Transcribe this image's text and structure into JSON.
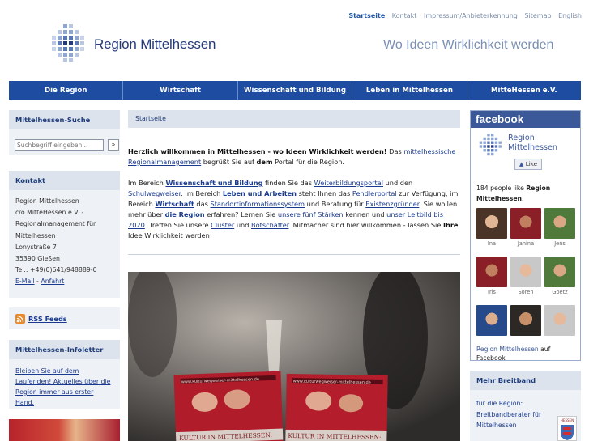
{
  "topnav": [
    "Startseite",
    "Kontakt",
    "Impressum/Anbieterkennung",
    "Sitemap",
    "English"
  ],
  "brand": {
    "logo_text": "Region Mittelhessen",
    "slogan": "Wo Ideen Wirklichkeit werden"
  },
  "mainnav": [
    "Die Region",
    "Wirtschaft",
    "Wissenschaft und Bildung",
    "Leben in Mittelhessen",
    "MitteHessen e.V."
  ],
  "search": {
    "title": "Mittelhessen-Suche",
    "placeholder": "Suchbegriff eingeben...",
    "button": "»"
  },
  "contact": {
    "title": "Kontakt",
    "lines": [
      "Region Mittelhessen",
      "c/o MitteHessen e.V. -",
      "Regionalmanagement für",
      "Mittelhessen",
      "Lonystraße 7",
      "35390 Gießen",
      "Tel.: +49(0)641/948889-0"
    ],
    "email": "E-Mail",
    "separator": " - ",
    "directions": "Anfahrt"
  },
  "rss": {
    "label": "RSS Feeds"
  },
  "infoletter": {
    "title": "Mittelhessen-Infoletter",
    "text": "Bleiben Sie auf dem Laufenden! Aktuelles über die Region immer aus erster Hand."
  },
  "breadcrumb": "Startseite",
  "intro": {
    "p1_bold": "Herzlich willkommen in Mittelhessen - wo Ideen Wirklichkeit werden!",
    "p1_a": " Das ",
    "p1_link": "mittelhessische Regionalmanagement",
    "p1_b": " begrüßt Sie auf ",
    "p1_bold2": "dem",
    "p1_c": " Portal für die Region.",
    "t1": "Im Bereich ",
    "l1": "Wissenschaft und Bildung",
    "t2": " finden Sie das ",
    "l2": "Weiterbildungsportal",
    "t3": " und den ",
    "l3": "Schulwegweiser",
    "t4": ". Im Bereich ",
    "l4": "Leben und Arbeiten",
    "t5": " steht Ihnen das ",
    "l5": "Pendlerportal",
    "t6": " zur Verfügung, im Bereich ",
    "l6": "Wirtschaft",
    "t7": " das ",
    "l7": "Standortinformationssystem",
    "t8": " und Beratung für ",
    "l8": "Existenzgründer",
    "t9": ". Sie wollen mehr über ",
    "l9": "die Region",
    "t10": " erfahren? Lernen Sie ",
    "l10": "unsere fünf Stärken",
    "t11": " kennen und ",
    "l11": "unser Leitbild bis 2020",
    "t12": ". Treffen Sie unsere ",
    "l12": "Cluster",
    "t13": " und ",
    "l13": "Botschafter",
    "t14": ". Mitmacher sind hier willkommen - lassen Sie ",
    "b14": "Ihre",
    "t15": " Idee Wirklichkeit werden!"
  },
  "photo": {
    "banner_left": "KULTUR IN MITTELHESSEN:",
    "banner_right": "KULTUR IN MITTELHESSEN:",
    "url_left": "www.kulturwegweiser-mittelhessen.de",
    "url_right": "www.kulturwegweiser-mittelhessen.de"
  },
  "facebook": {
    "header": "facebook",
    "page_name": "Region Mittelhessen",
    "like": "Like",
    "count_a": "184 people like ",
    "count_bold": "Region Mittelhessen",
    "count_b": ".",
    "fans": [
      "Ina",
      "Janina",
      "Jens",
      "Iris",
      "Soren",
      "Goetz",
      "",
      "",
      ""
    ],
    "footer_link": "Region Mittelhessen",
    "footer_a": " auf",
    "footer_b": "Facebook"
  },
  "breitband": {
    "title": "Mehr Breitband",
    "text": "für die Region: Breitbandberater für Mittelhessen",
    "logo_text": "HESSEN"
  },
  "colors": {
    "nav": "#1e4ca0",
    "box_head": "#dde3ec",
    "facebook": "#3b5998",
    "link": "#1a3a8f"
  }
}
